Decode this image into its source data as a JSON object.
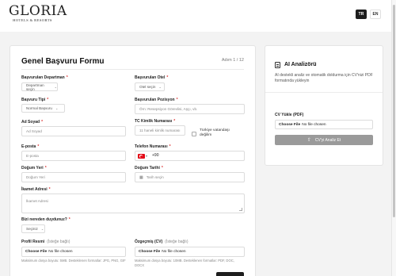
{
  "logo": {
    "main": "GLORIA",
    "sub": "HOTELS & RESORTS"
  },
  "lang": {
    "tr": "TR",
    "en": "EN"
  },
  "form": {
    "title": "Genel Başvuru Formu",
    "step": "Adım 1 / 12",
    "department": {
      "label": "Başvurulan Departman",
      "value": "Departman seçin"
    },
    "hotel": {
      "label": "Başvurulan Otel",
      "value": "Otel seçin"
    },
    "type": {
      "label": "Başvuru Tipi",
      "value": "Normal Başvuru"
    },
    "position": {
      "label": "Başvurulan Pozisyon",
      "placeholder": "Örn: Resepsiyon Görevlisi, Aşçı, vb."
    },
    "fullname": {
      "label": "Ad Soyad",
      "placeholder": "Ad Soyad"
    },
    "tc": {
      "label": "TC Kimlik Numarası",
      "placeholder": "11 haneli kimlik numarası"
    },
    "foreign": {
      "label": "Türkiye vatandaşı değilim"
    },
    "email": {
      "label": "E-posta",
      "placeholder": "E-posta"
    },
    "phone": {
      "label": "Telefon Numarası",
      "code": "+90"
    },
    "birthplace": {
      "label": "Doğum Yeri",
      "placeholder": "Doğum Yeri"
    },
    "birthdate": {
      "label": "Doğum Tarihi",
      "placeholder": "Tarih seçin"
    },
    "address": {
      "label": "İkamet Adresi",
      "placeholder": "İkamet Adresi"
    },
    "source": {
      "label": "Bizi nereden duydunuz?",
      "value": "Seçiniz"
    },
    "photo": {
      "label": "Profil Resmi",
      "optional": "(İsteğe bağlı)",
      "button": "Choose File",
      "status": "No file chosen",
      "hint": "Maksimum dosya boyutu: 5MB. Desteklenen formatlar: JPG, PNG, GIF"
    },
    "cv": {
      "label": "Özgeçmiş (CV)",
      "optional": "(İsteğe bağlı)",
      "button": "Choose File",
      "status": "No file chosen",
      "hint": "Maksimum dosya boyutu: 10MB. Desteklenen formatlar: PDF, DOC, DOCX"
    }
  },
  "ai": {
    "title": "AI Analizörü",
    "description": "AI destekli analiz ve otomatik doldurma için CV'nizi PDF formatında yükleyin",
    "cv_label": "CV Yükle (PDF)",
    "file_button": "Choose File",
    "file_status": "No file chosen",
    "analyze_button": "CV'yi Analiz Et"
  },
  "colors": {
    "accent": "#1d1d1d",
    "required": "#dd3333",
    "disabled_button": "#9a9a9a"
  }
}
